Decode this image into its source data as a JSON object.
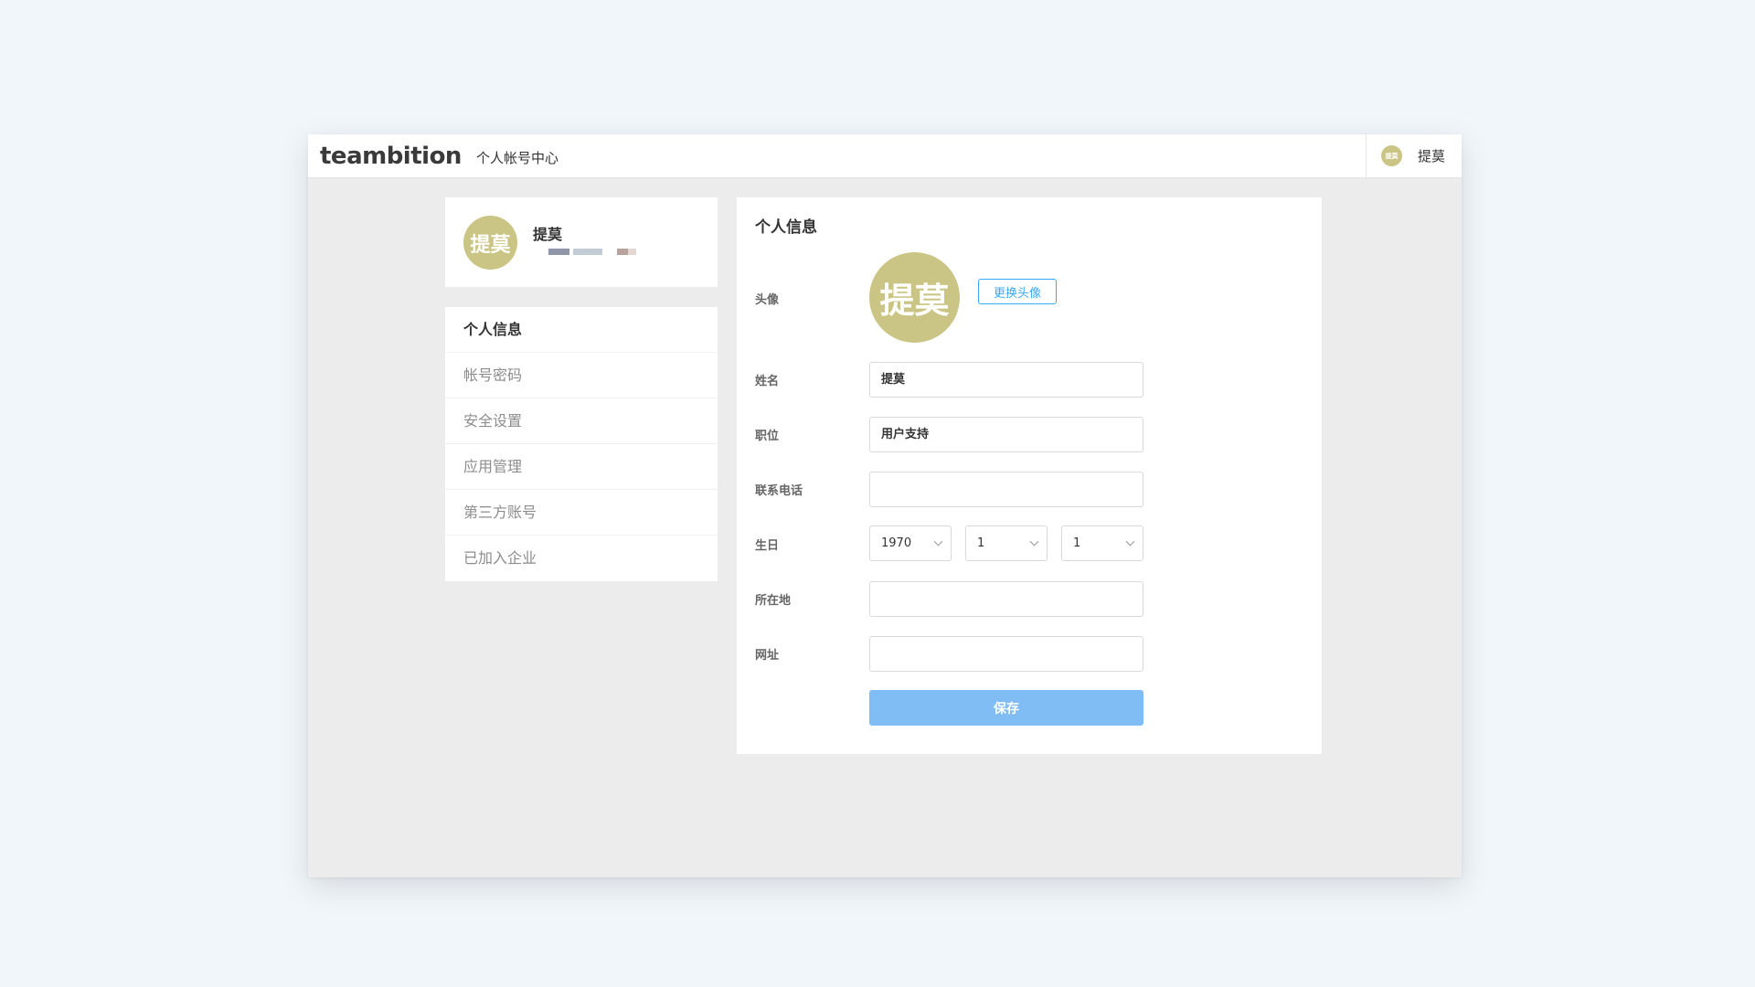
{
  "header": {
    "logo": "teambition",
    "title": "个人帐号中心",
    "user": {
      "avatar_text": "提莫",
      "name": "提莫"
    }
  },
  "profile_card": {
    "avatar_text": "提莫",
    "name": "提莫"
  },
  "sidebar": {
    "items": [
      {
        "label": "个人信息",
        "active": true
      },
      {
        "label": "帐号密码"
      },
      {
        "label": "安全设置"
      },
      {
        "label": "应用管理"
      },
      {
        "label": "第三方账号"
      },
      {
        "label": "已加入企业"
      }
    ]
  },
  "form": {
    "title": "个人信息",
    "avatar": {
      "label": "头像",
      "text": "提莫",
      "change_label": "更换头像"
    },
    "name": {
      "label": "姓名",
      "value": "提莫"
    },
    "position": {
      "label": "职位",
      "value": "用户支持"
    },
    "phone": {
      "label": "联系电话",
      "value": ""
    },
    "birthday": {
      "label": "生日",
      "year": "1970",
      "month": "1",
      "day": "1"
    },
    "location": {
      "label": "所在地",
      "value": ""
    },
    "website": {
      "label": "网址",
      "value": ""
    },
    "save_label": "保存"
  },
  "colors": {
    "avatar_bg": "#cbc585",
    "accent": "#3da8f5",
    "save_button": "#80bdf4",
    "page_bg": "#f1f6fb",
    "window_bg": "#ececec"
  }
}
